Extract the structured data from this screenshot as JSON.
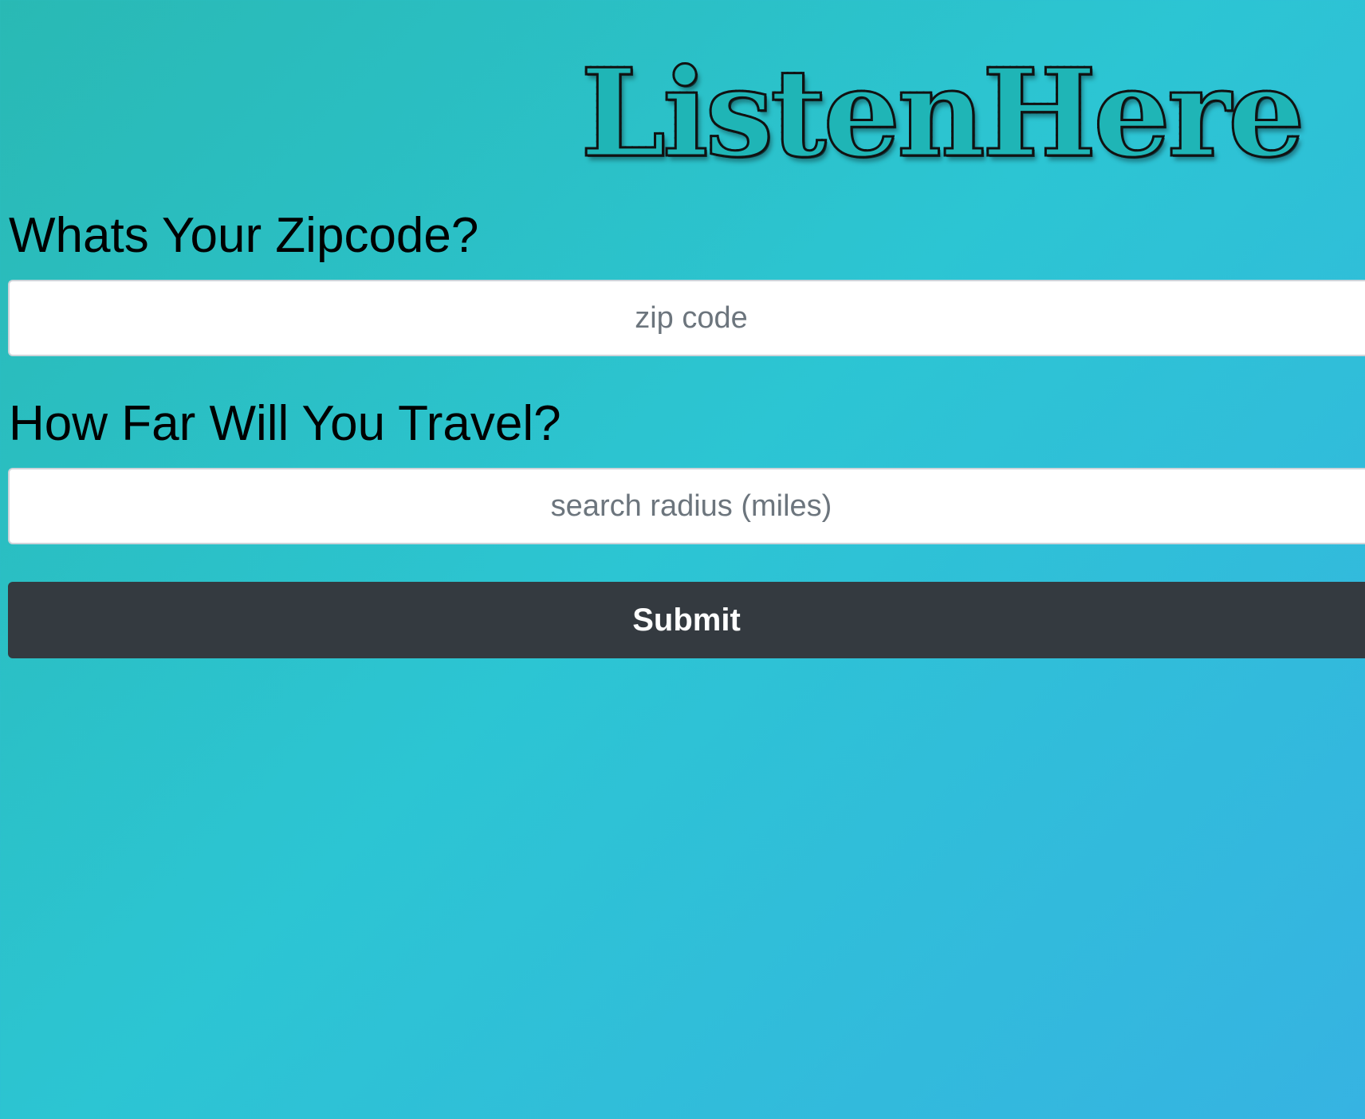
{
  "brand": {
    "logo_text": "ListenHere"
  },
  "form": {
    "zipcode_question": "Whats Your Zipcode?",
    "zipcode_placeholder": "zip code",
    "zipcode_value": "",
    "radius_question": "How Far Will You Travel?",
    "radius_placeholder": "search radius (miles)",
    "radius_value": "",
    "submit_label": "Submit"
  },
  "colors": {
    "background_start": "#29b9b4",
    "background_mid": "#2cc5d3",
    "background_end": "#36b3e2",
    "button": "#343a40",
    "button_text": "#ffffff",
    "input_background": "#ffffff",
    "placeholder_text": "#6c757d",
    "question_text": "#000000"
  }
}
